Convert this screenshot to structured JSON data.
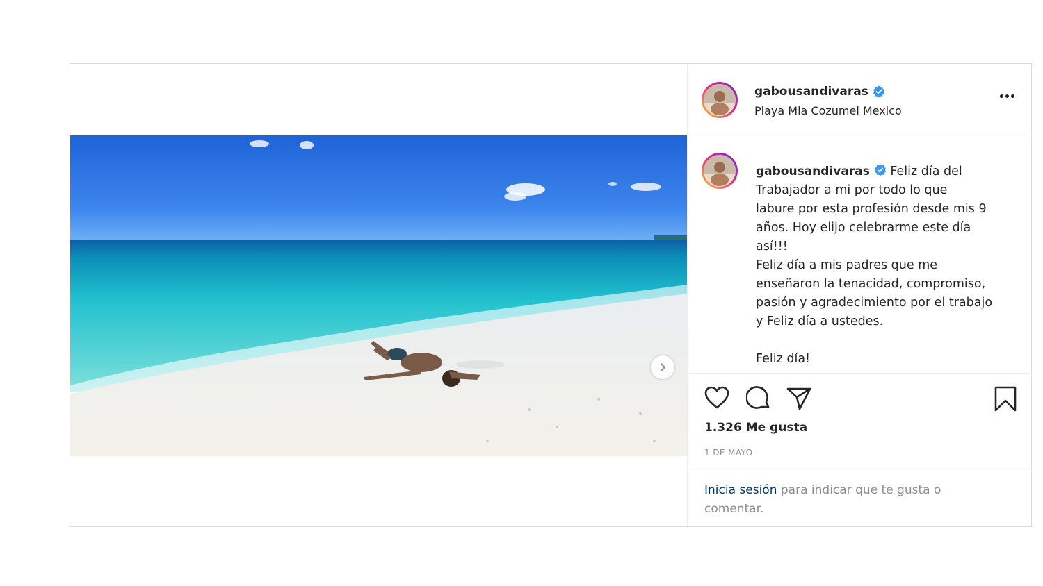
{
  "post": {
    "username": "gabousandivaras",
    "location": "Playa Mia Cozumel Mexico",
    "caption_first_line": "Feliz día del",
    "caption_rest": "Trabajador a mi por todo lo que\nlabure por esta profesión desde mis 9\naños. Hoy elijo celebrarme este día\nasí!!!\nFeliz día a mis padres que me\nenseñaron la tenacidad, compromiso,\npasión y agradecimiento por el trabajo\ny Feliz día a ustedes.\n\nFeliz día!",
    "likes": "1.326 Me gusta",
    "date": "1 DE MAYO",
    "login_link": "Inicia sesión",
    "login_rest": " para indicar que te gusta o comentar.",
    "carousel": {
      "count": 2,
      "active": 0
    }
  },
  "icons": {
    "verified": "verified-badge-icon",
    "more": "more-options-icon",
    "like": "heart-icon",
    "comment": "comment-icon",
    "share": "paper-plane-icon",
    "save": "bookmark-icon",
    "next": "chevron-right-icon"
  },
  "colors": {
    "verified_blue": "#3897f0",
    "link": "#00376b",
    "muted": "#8e8e8e",
    "border": "#dbdbdb"
  }
}
